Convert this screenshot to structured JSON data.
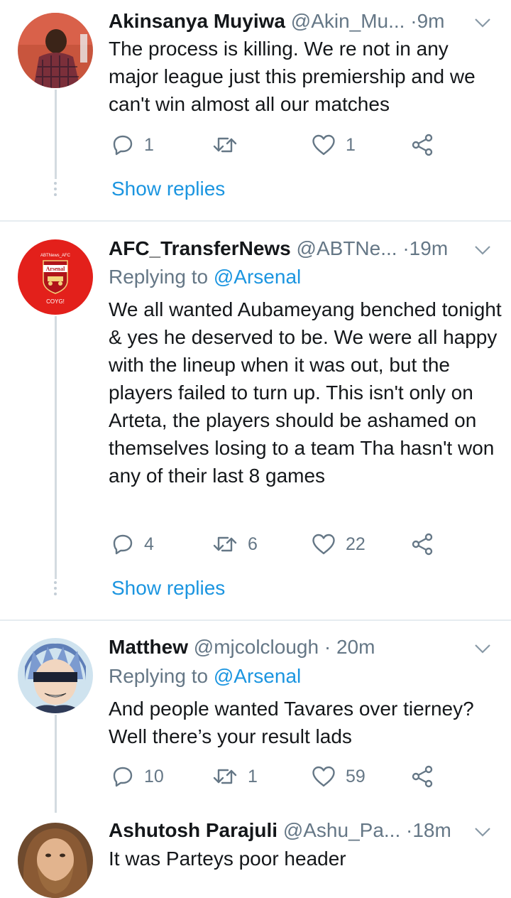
{
  "tweets": [
    {
      "name": "Akinsanya Muyiwa",
      "handle": "@Akin_Mu...",
      "dot": "·",
      "time": "9m",
      "replying_label": "",
      "replying_mention": "",
      "text": "The process is killing. We re not in any major league just this premiership and we can't win almost all our matches",
      "replies": "1",
      "retweets": "",
      "likes": "1",
      "show_replies": "Show replies",
      "avatar_icon": "person-in-plaid-shirt-avatar"
    },
    {
      "name": "AFC_TransferNews",
      "handle": "@ABTNe...",
      "dot": "·",
      "time": "19m",
      "replying_label": "Replying to ",
      "replying_mention": "@Arsenal",
      "text": "We all wanted Aubameyang benched tonight & yes he deserved to be. We were all happy with the lineup when it was out, but the players failed to turn up. This isn't only on Arteta, the players should be ashamed on themselves losing to a team Tha hasn't won any of their last 8 games",
      "replies": "4",
      "retweets": "6",
      "likes": "22",
      "show_replies": "Show replies",
      "avatar_icon": "arsenal-crest-avatar",
      "avatar_text": {
        "top": "ABTNews_AFC",
        "crest": "Arsenal",
        "bottom": "COYG!"
      }
    },
    {
      "name": "Matthew",
      "handle": "@mjcolclough",
      "dot": "·",
      "time": "20m",
      "replying_label": "Replying to ",
      "replying_mention": "@Arsenal",
      "text": "And people wanted Tavares over tierney? Well there’s your result lads",
      "replies": "10",
      "retweets": "1",
      "likes": "59",
      "show_replies": "",
      "avatar_icon": "anime-character-avatar"
    },
    {
      "name": "Ashutosh Parajuli",
      "handle": "@Ashu_Pa...",
      "dot": "·",
      "time": "18m",
      "replying_label": "",
      "replying_mention": "",
      "text": "It was Parteys poor header",
      "replies": "",
      "retweets": "",
      "likes": "",
      "show_replies": "",
      "avatar_icon": "bearded-man-avatar"
    }
  ],
  "colors": {
    "text": "#14171a",
    "secondary": "#657786",
    "link": "#1b95e0",
    "divider": "#e6ecf0",
    "arsenal_red": "#e3201b"
  },
  "icons": {
    "reply": "reply-icon",
    "retweet": "retweet-icon",
    "like": "heart-icon",
    "share": "share-icon",
    "more": "chevron-down-icon"
  }
}
